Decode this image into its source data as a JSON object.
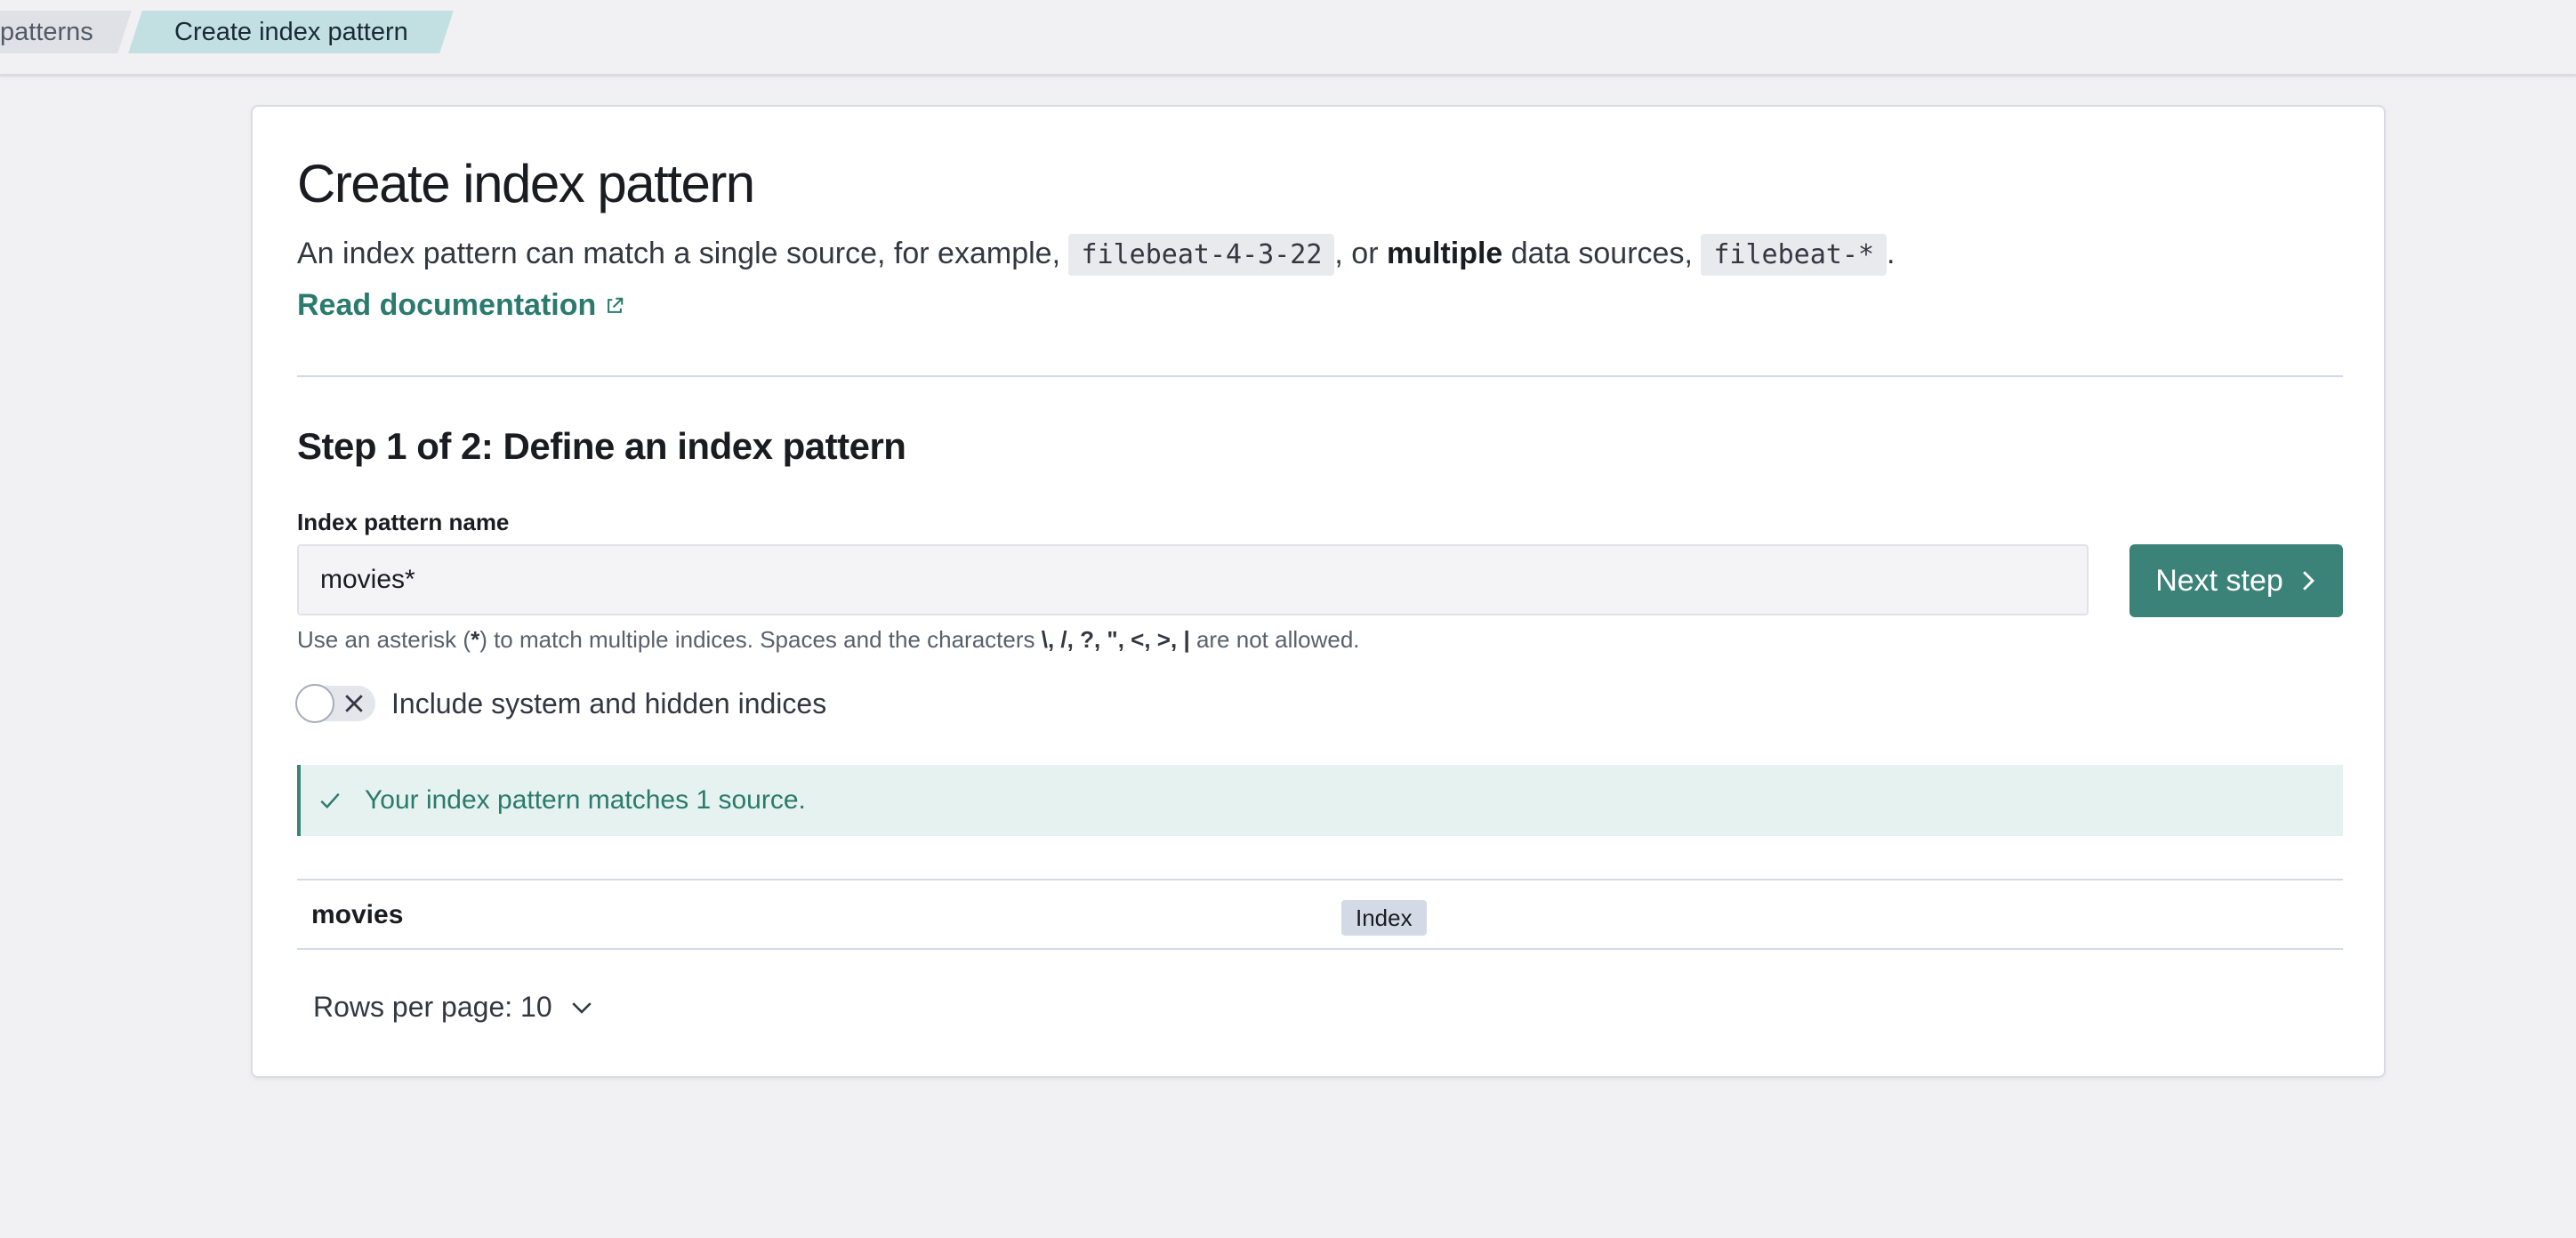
{
  "breadcrumbs": {
    "previous": "patterns",
    "current": "Create index pattern"
  },
  "page": {
    "title": "Create index pattern",
    "description_part1": "An index pattern can match a single source, for example, ",
    "example_single": "filebeat-4-3-22",
    "description_part2": ", or ",
    "description_bold": "multiple",
    "description_part3": " data sources, ",
    "example_multiple": "filebeat-*",
    "description_part4": ".",
    "doc_link": "Read documentation"
  },
  "step": {
    "title": "Step 1 of 2: Define an index pattern",
    "field_label": "Index pattern name",
    "field_value": "movies*",
    "next_button": "Next step",
    "help_part1": "Use an asterisk (",
    "help_asterisk": "*",
    "help_part2": ") to match multiple indices. Spaces and the characters ",
    "help_chars": "\\, /, ?, \", <, >, |",
    "help_part3": " are not allowed.",
    "toggle_label": "Include system and hidden indices",
    "toggle_on": false
  },
  "callout": {
    "text": "Your index pattern matches 1 source."
  },
  "table": {
    "rows": [
      {
        "name": "movies",
        "type": "Index"
      }
    ],
    "rows_per_page": "Rows per page: 10"
  },
  "colors": {
    "accent": "#3b8379",
    "success_bg": "#e6f2ef",
    "breadcrumb_active": "#c2dfe2"
  }
}
